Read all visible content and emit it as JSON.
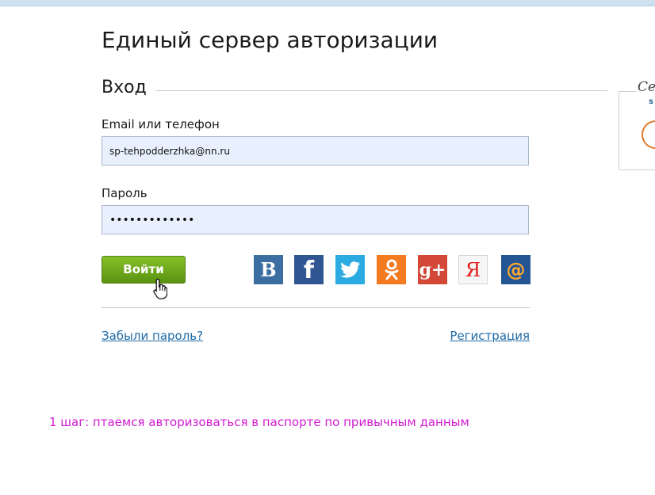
{
  "page": {
    "title": "Единый сервер авторизации",
    "section_title": "Вход"
  },
  "form": {
    "login_label": "Email или телефон",
    "login_value": "sp-tehpodderzhka@nn.ru",
    "password_label": "Пароль",
    "password_value": "•••••••••••••",
    "submit_label": "Войти"
  },
  "social": {
    "vk": "B",
    "facebook": "f",
    "twitter": "twitter-icon",
    "odnoklassniki": "odnoklassniki-icon",
    "google_plus": "g+",
    "yandex": "Я",
    "mailru": "@"
  },
  "links": {
    "forgot": "Забыли пароль?",
    "register": "Регистрация"
  },
  "side_card": {
    "title": "Cer",
    "subtitle": "s"
  },
  "annotation": "1 шаг: птаемся авторизоваться в паспорте по привычным данным",
  "colors": {
    "accent_green": "#6aa81a",
    "link_blue": "#1e6aa6",
    "annotation_magenta": "#d21bd2",
    "input_bg": "#e8f0fe"
  }
}
